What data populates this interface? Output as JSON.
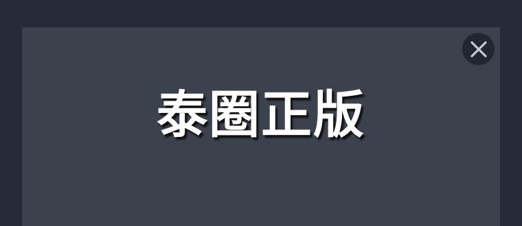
{
  "modal": {
    "title": "泰圈正版",
    "close_icon": "close-icon"
  },
  "colors": {
    "page_background": "#262b3a",
    "panel_background": "#3c414e",
    "close_button_background": "#222630",
    "close_icon": "#c9cbd0",
    "title_text": "#ffffff"
  }
}
